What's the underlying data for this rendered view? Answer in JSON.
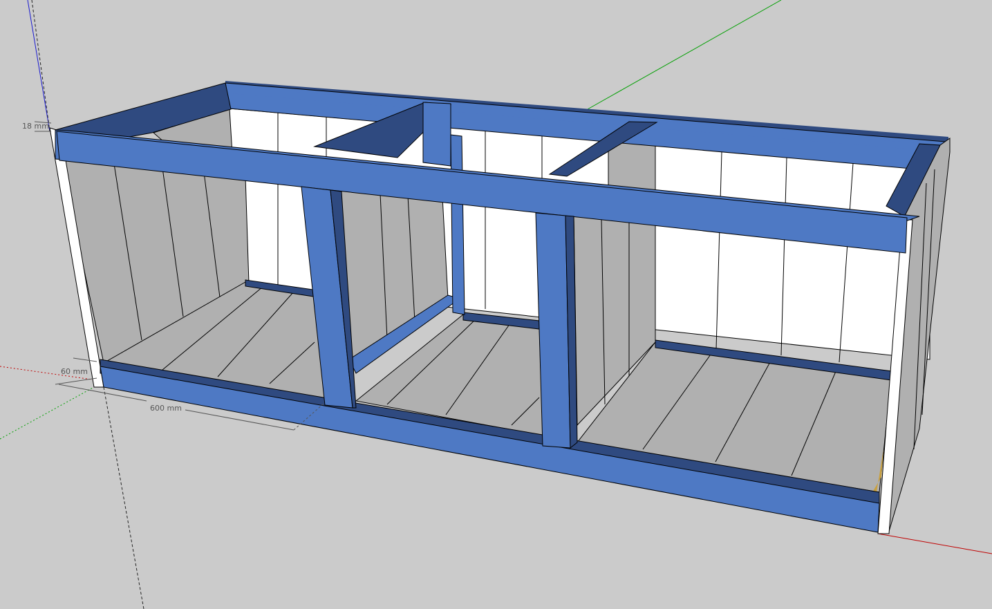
{
  "colors": {
    "background": "#cbcbcb",
    "frame_blue": "#4e79c4",
    "frame_shadow": "#2f4a80",
    "frame_dark": "#1f3360",
    "panel_grey": "#b0b0b0",
    "panel_light": "#bcbcbc",
    "panel_white": "#ffffff",
    "axis_red": "#c00000",
    "axis_green": "#00a000",
    "axis_blue": "#1a1ad0",
    "accent_tan": "#c8a040"
  },
  "dimensions": {
    "thickness_label": "18 mm",
    "rail_height_label": "60 mm",
    "depth_label": "600 mm"
  },
  "icons": {
    "axes": "model-axes-icon"
  }
}
